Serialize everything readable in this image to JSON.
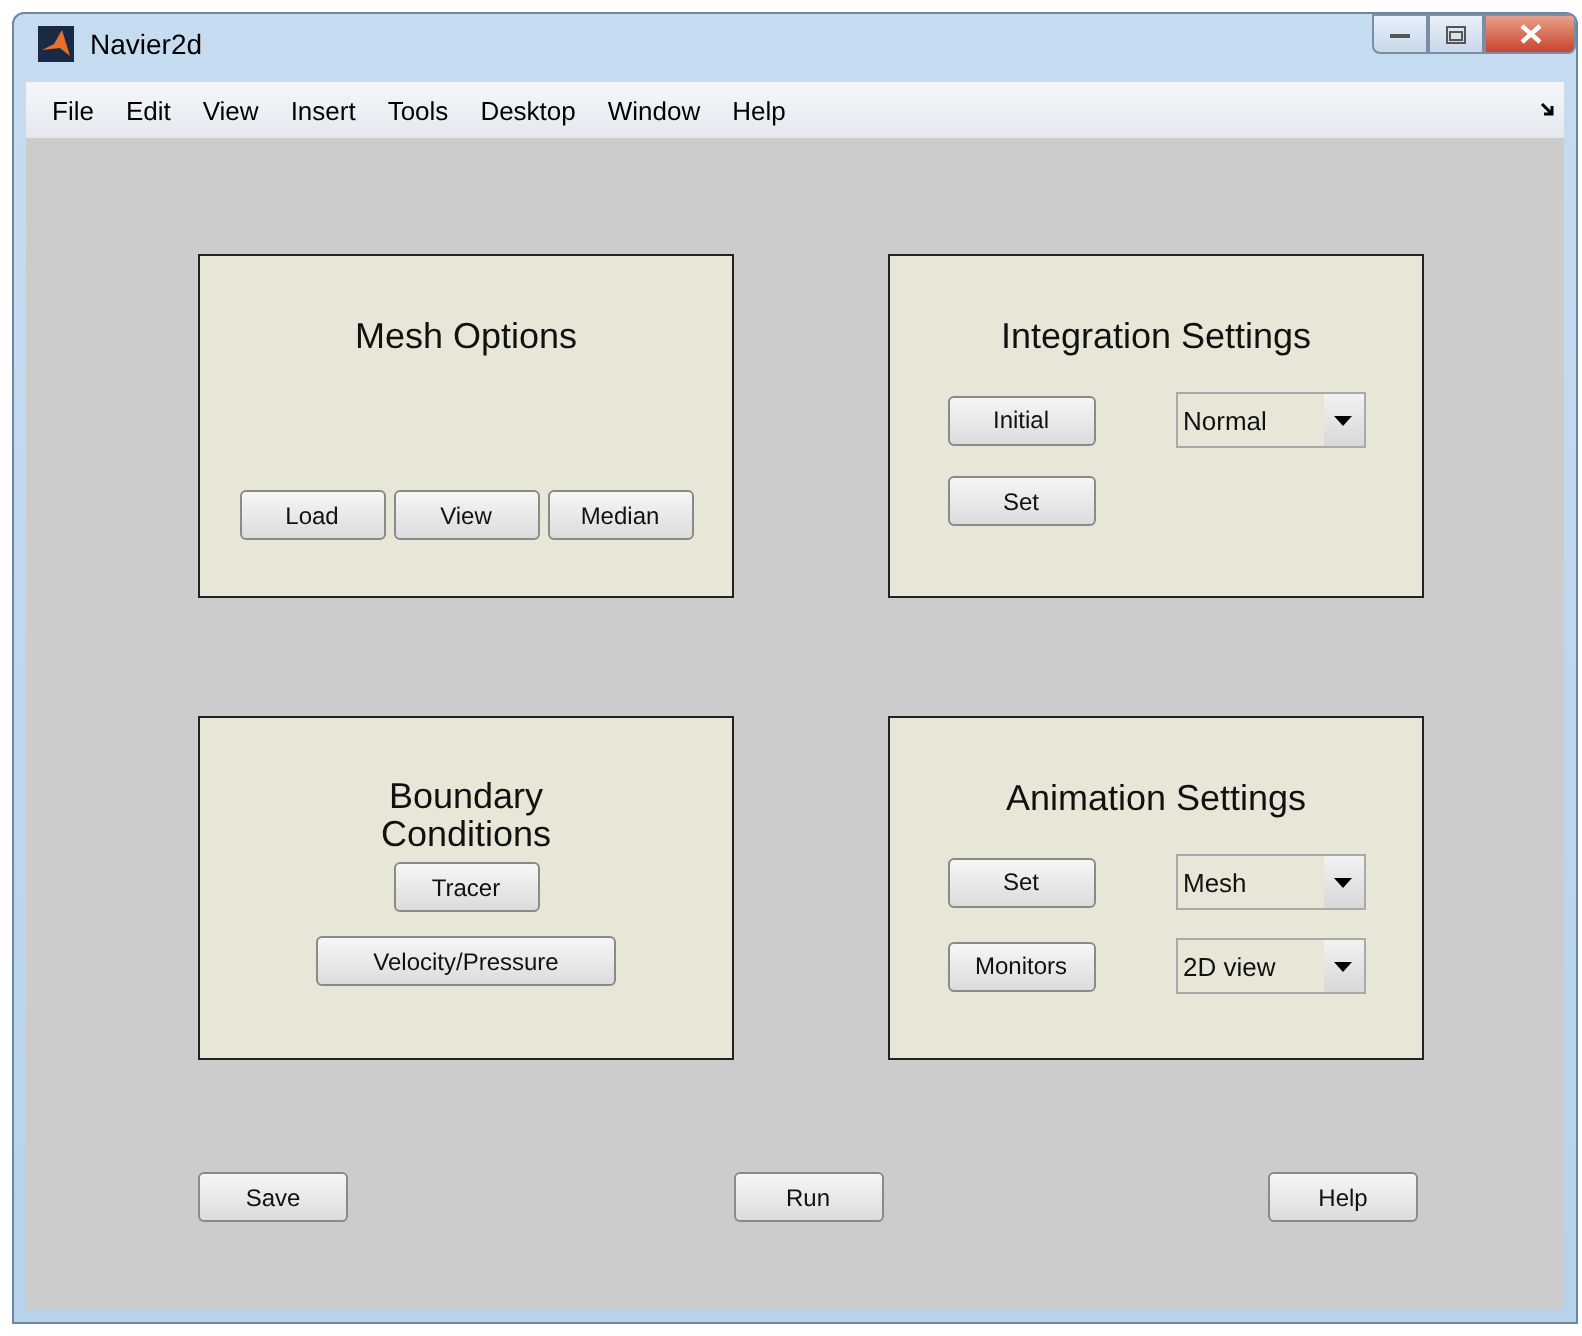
{
  "window": {
    "title": "Navier2d"
  },
  "menu": [
    "File",
    "Edit",
    "View",
    "Insert",
    "Tools",
    "Desktop",
    "Window",
    "Help"
  ],
  "panels": [
    {
      "title": "Mesh Options",
      "kind": "row",
      "controls": [
        {
          "kind": "button",
          "label": "Load"
        },
        {
          "kind": "button",
          "label": "View"
        },
        {
          "kind": "button",
          "label": "Median"
        }
      ]
    },
    {
      "title": "Integration Settings",
      "kind": "grid",
      "controls": [
        {
          "kind": "button",
          "label": "Initial"
        },
        {
          "kind": "dropdown",
          "value": "Normal"
        },
        {
          "kind": "button",
          "label": "Set"
        }
      ]
    },
    {
      "title": "Boundary Conditions",
      "kind": "stack",
      "controls": [
        {
          "kind": "button",
          "label": "Tracer"
        },
        {
          "kind": "button",
          "label": "Velocity/Pressure"
        }
      ]
    },
    {
      "title": "Animation Settings",
      "kind": "grid",
      "controls": [
        {
          "kind": "button",
          "label": "Set"
        },
        {
          "kind": "dropdown",
          "value": "Mesh"
        },
        {
          "kind": "button",
          "label": "Monitors"
        },
        {
          "kind": "dropdown",
          "value": "2D view"
        }
      ]
    }
  ],
  "buttons": [
    "Save",
    "Run",
    "Help"
  ]
}
